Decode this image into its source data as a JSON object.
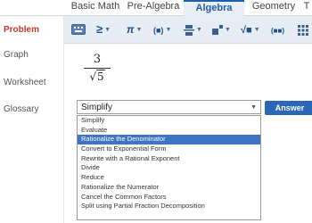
{
  "top_tabs": [
    {
      "label": "Basic Math"
    },
    {
      "label": "Pre-Algebra"
    },
    {
      "label": "Algebra",
      "active": true
    },
    {
      "label": "Geometry"
    },
    {
      "label": "T"
    }
  ],
  "sidebar": {
    "items": [
      {
        "label": "Problem",
        "active": true
      },
      {
        "label": "Graph"
      },
      {
        "label": "Worksheet"
      },
      {
        "label": "Glossary"
      }
    ]
  },
  "toolbar": {
    "buttons": [
      {
        "icon": "keyboard-icon"
      },
      {
        "icon": "greater-equal-icon",
        "glyph": "≥"
      },
      {
        "icon": "pi-icon",
        "glyph": "π"
      },
      {
        "icon": "parentheses-icon",
        "glyph": "(■)"
      },
      {
        "icon": "fraction-icon"
      },
      {
        "icon": "exponent-icon"
      },
      {
        "icon": "sqrt-icon",
        "glyph": "√■"
      },
      {
        "icon": "matrix-icon",
        "glyph": "(■■)"
      },
      {
        "icon": "grid-icon"
      }
    ]
  },
  "expression": {
    "numerator": "3",
    "radical": "√",
    "radicand": "5"
  },
  "operation_select": {
    "value": "Simplify",
    "options": [
      "Simplify",
      "Evaluate",
      "Rationalize the Denominator",
      "Convert to Exponential Form",
      "Rewrite with a Rational Exponent",
      "Divide",
      "Reduce",
      "Rationalize the Numerator",
      "Cancel the Common Factors",
      "Split using Partial Fraction Decomposition"
    ],
    "highlighted": "Rationalize the Denominator"
  },
  "answer_button": {
    "label": "Answer"
  },
  "colors": {
    "accent": "#1f5ea8",
    "answer_button": "#2a67b5",
    "active_sidebar": "#c0392b",
    "highlight": "#3f74c4",
    "toolbar_bg": "#e6edf5"
  }
}
